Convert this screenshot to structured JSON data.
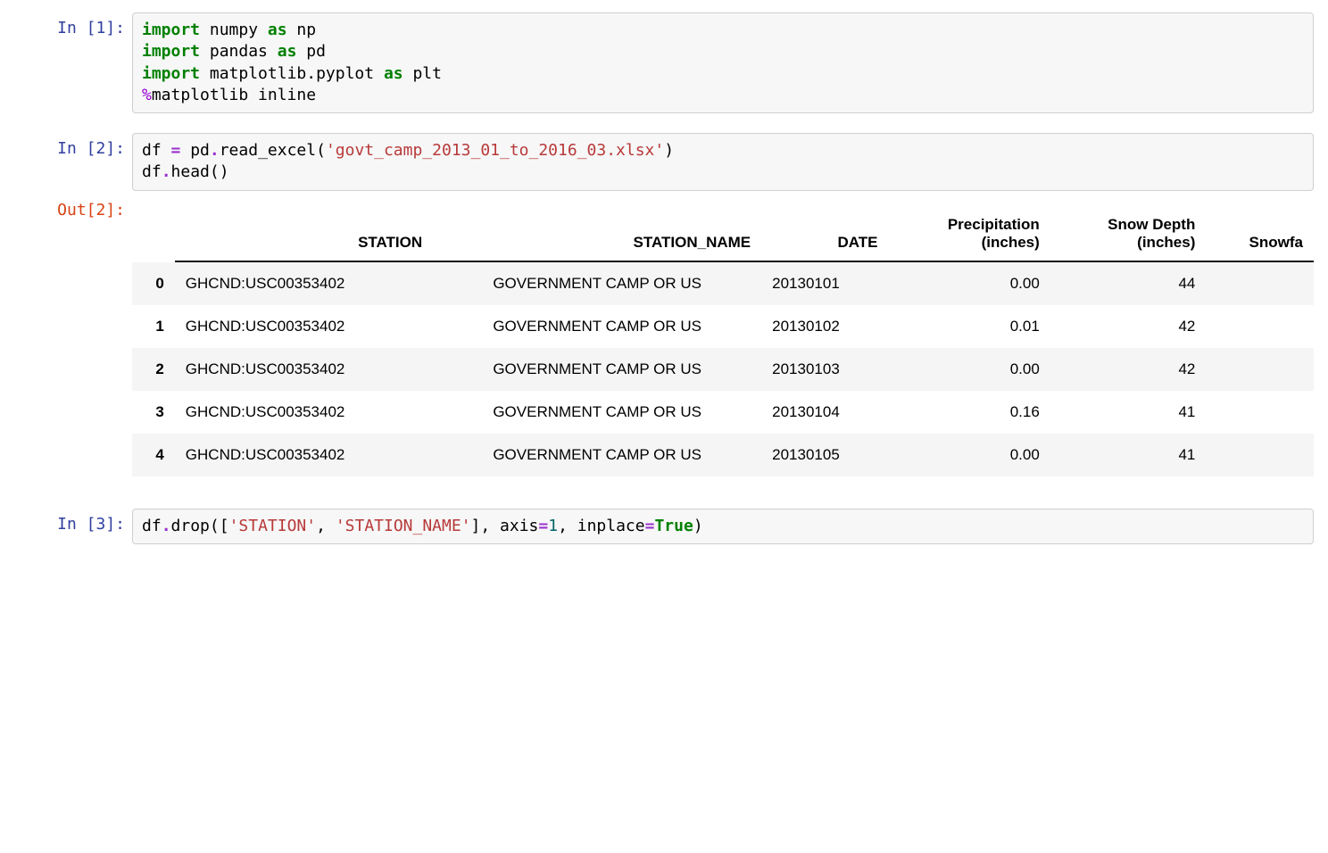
{
  "cells": [
    {
      "prompt": "In [1]:",
      "code_tokens": [
        {
          "t": "import",
          "c": "kw"
        },
        {
          "t": " numpy ",
          "c": "nm"
        },
        {
          "t": "as",
          "c": "kw"
        },
        {
          "t": " np\n",
          "c": "nm"
        },
        {
          "t": "import",
          "c": "kw"
        },
        {
          "t": " pandas ",
          "c": "nm"
        },
        {
          "t": "as",
          "c": "kw"
        },
        {
          "t": " pd\n",
          "c": "nm"
        },
        {
          "t": "import",
          "c": "kw"
        },
        {
          "t": " matplotlib.pyplot ",
          "c": "nm"
        },
        {
          "t": "as",
          "c": "kw"
        },
        {
          "t": " plt\n",
          "c": "nm"
        },
        {
          "t": "%",
          "c": "mag"
        },
        {
          "t": "matplotlib inline",
          "c": "nm"
        }
      ]
    },
    {
      "prompt": "In [2]:",
      "code_tokens": [
        {
          "t": "df ",
          "c": "nm"
        },
        {
          "t": "=",
          "c": "op"
        },
        {
          "t": " pd",
          "c": "nm"
        },
        {
          "t": ".",
          "c": "op"
        },
        {
          "t": "read_excel",
          "c": "nm"
        },
        {
          "t": "(",
          "c": "par"
        },
        {
          "t": "'govt_camp_2013_01_to_2016_03.xlsx'",
          "c": "str"
        },
        {
          "t": ")\n",
          "c": "par"
        },
        {
          "t": "df",
          "c": "nm"
        },
        {
          "t": ".",
          "c": "op"
        },
        {
          "t": "head",
          "c": "nm"
        },
        {
          "t": "()",
          "c": "par"
        }
      ]
    },
    {
      "prompt": "In [3]:",
      "code_tokens": [
        {
          "t": "df",
          "c": "nm"
        },
        {
          "t": ".",
          "c": "op"
        },
        {
          "t": "drop",
          "c": "nm"
        },
        {
          "t": "([",
          "c": "par"
        },
        {
          "t": "'STATION'",
          "c": "str"
        },
        {
          "t": ", ",
          "c": "nm"
        },
        {
          "t": "'STATION_NAME'",
          "c": "str"
        },
        {
          "t": "], axis",
          "c": "nm"
        },
        {
          "t": "=",
          "c": "op"
        },
        {
          "t": "1",
          "c": "num-lit"
        },
        {
          "t": ", inplace",
          "c": "nm"
        },
        {
          "t": "=",
          "c": "op"
        },
        {
          "t": "True",
          "c": "bool"
        },
        {
          "t": ")",
          "c": "par"
        }
      ]
    }
  ],
  "output_prompt": "Out[2]:",
  "table": {
    "columns": [
      "",
      "STATION",
      "STATION_NAME",
      "DATE",
      "Precipitation\\n(inches)",
      "Snow Depth\\n(inches)",
      "Snowfa"
    ],
    "rows": [
      {
        "idx": "0",
        "station": "GHCND:USC00353402",
        "station_name": "GOVERNMENT CAMP OR US",
        "date": "20130101",
        "precip": "0.00",
        "snow_depth": "44"
      },
      {
        "idx": "1",
        "station": "GHCND:USC00353402",
        "station_name": "GOVERNMENT CAMP OR US",
        "date": "20130102",
        "precip": "0.01",
        "snow_depth": "42"
      },
      {
        "idx": "2",
        "station": "GHCND:USC00353402",
        "station_name": "GOVERNMENT CAMP OR US",
        "date": "20130103",
        "precip": "0.00",
        "snow_depth": "42"
      },
      {
        "idx": "3",
        "station": "GHCND:USC00353402",
        "station_name": "GOVERNMENT CAMP OR US",
        "date": "20130104",
        "precip": "0.16",
        "snow_depth": "41"
      },
      {
        "idx": "4",
        "station": "GHCND:USC00353402",
        "station_name": "GOVERNMENT CAMP OR US",
        "date": "20130105",
        "precip": "0.00",
        "snow_depth": "41"
      }
    ]
  }
}
